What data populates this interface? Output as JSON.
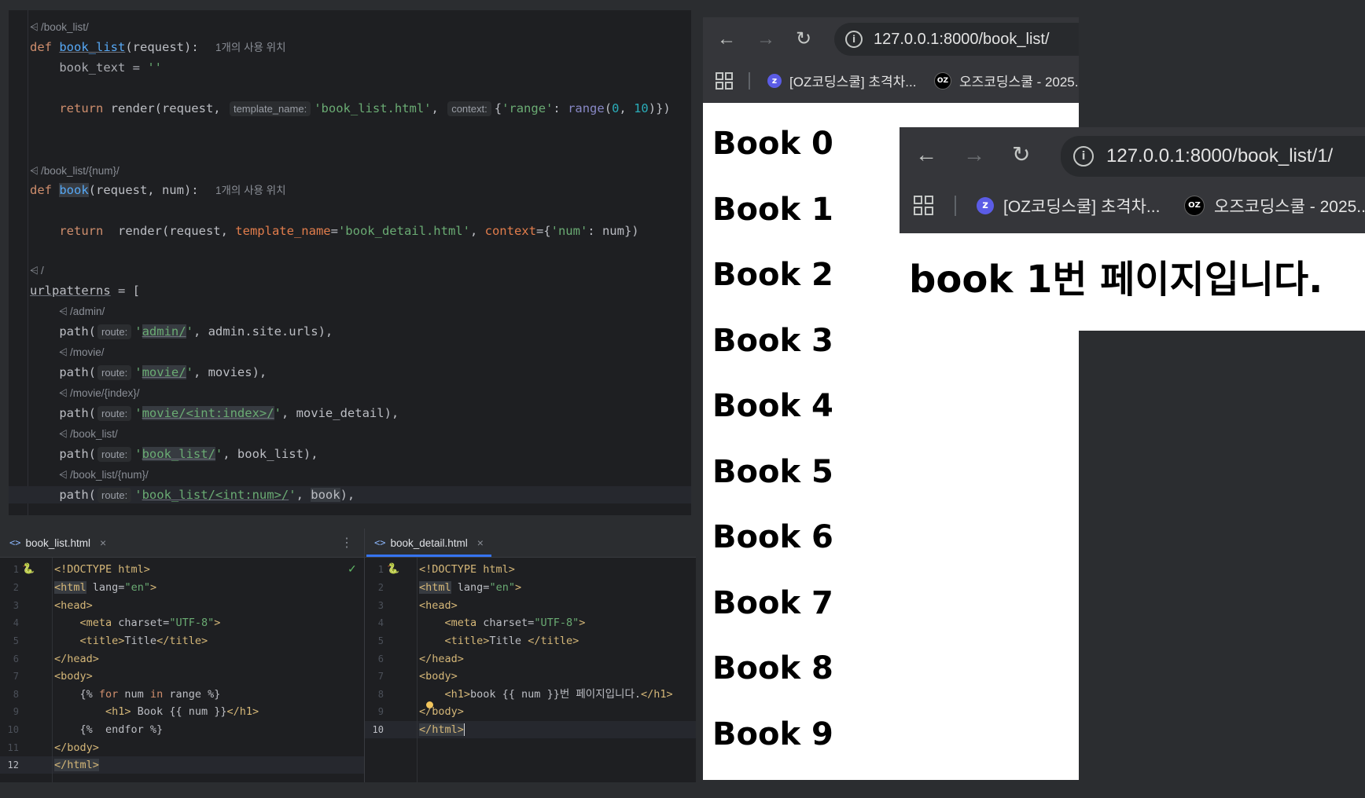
{
  "python_editor": {
    "url_hints": {
      "book_list": "/book_list/",
      "book": "/book_list/{num}/",
      "root": "/",
      "admin": "/admin/",
      "movie": "/movie/",
      "movie_detail": "/movie/{index}/",
      "book_list_route": "/book_list/",
      "book_route": "/book_list/{num}/"
    },
    "usage_text_1": "1개의 사용 위치",
    "usage_text_2": "1개의 사용 위치",
    "inlay": {
      "template_name": "template_name:",
      "context": "context:",
      "route": "route:"
    }
  },
  "tabs": {
    "left": {
      "label": "book_list.html"
    },
    "right": {
      "label": "book_detail.html"
    }
  },
  "book_list_code": {
    "line_numbers": [
      "1",
      "2",
      "3",
      "4",
      "5",
      "6",
      "7",
      "8",
      "9",
      "10",
      "11",
      "12"
    ],
    "current_line": "12"
  },
  "book_detail_code": {
    "line_numbers": [
      "1",
      "2",
      "3",
      "4",
      "5",
      "6",
      "7",
      "8",
      "9",
      "10"
    ],
    "current_line": "10"
  },
  "browser_main": {
    "url": "127.0.0.1:8000/book_list/",
    "bookmarks": [
      "[OZ코딩스쿨] 초격차...",
      "오즈코딩스쿨 - 2025..."
    ],
    "headings": [
      "Book 0",
      "Book 1",
      "Book 2",
      "Book 3",
      "Book 4",
      "Book 5",
      "Book 6",
      "Book 7",
      "Book 8",
      "Book 9"
    ]
  },
  "browser_detail": {
    "url": "127.0.0.1:8000/book_list/1/",
    "bookmarks": [
      "[OZ코딩스쿨] 초격차...",
      "오즈코딩스쿨 - 2025..."
    ],
    "heading": "book 1번 페이지입니다."
  },
  "colors": {
    "ide_bg": "#1e1f22",
    "keyword": "#cf8e6d",
    "function": "#56a8f5",
    "string": "#6aab73",
    "number": "#2aacb8",
    "tag": "#d5b778",
    "tab_underline": "#3574f0",
    "browser_toolbar": "#35363a"
  }
}
